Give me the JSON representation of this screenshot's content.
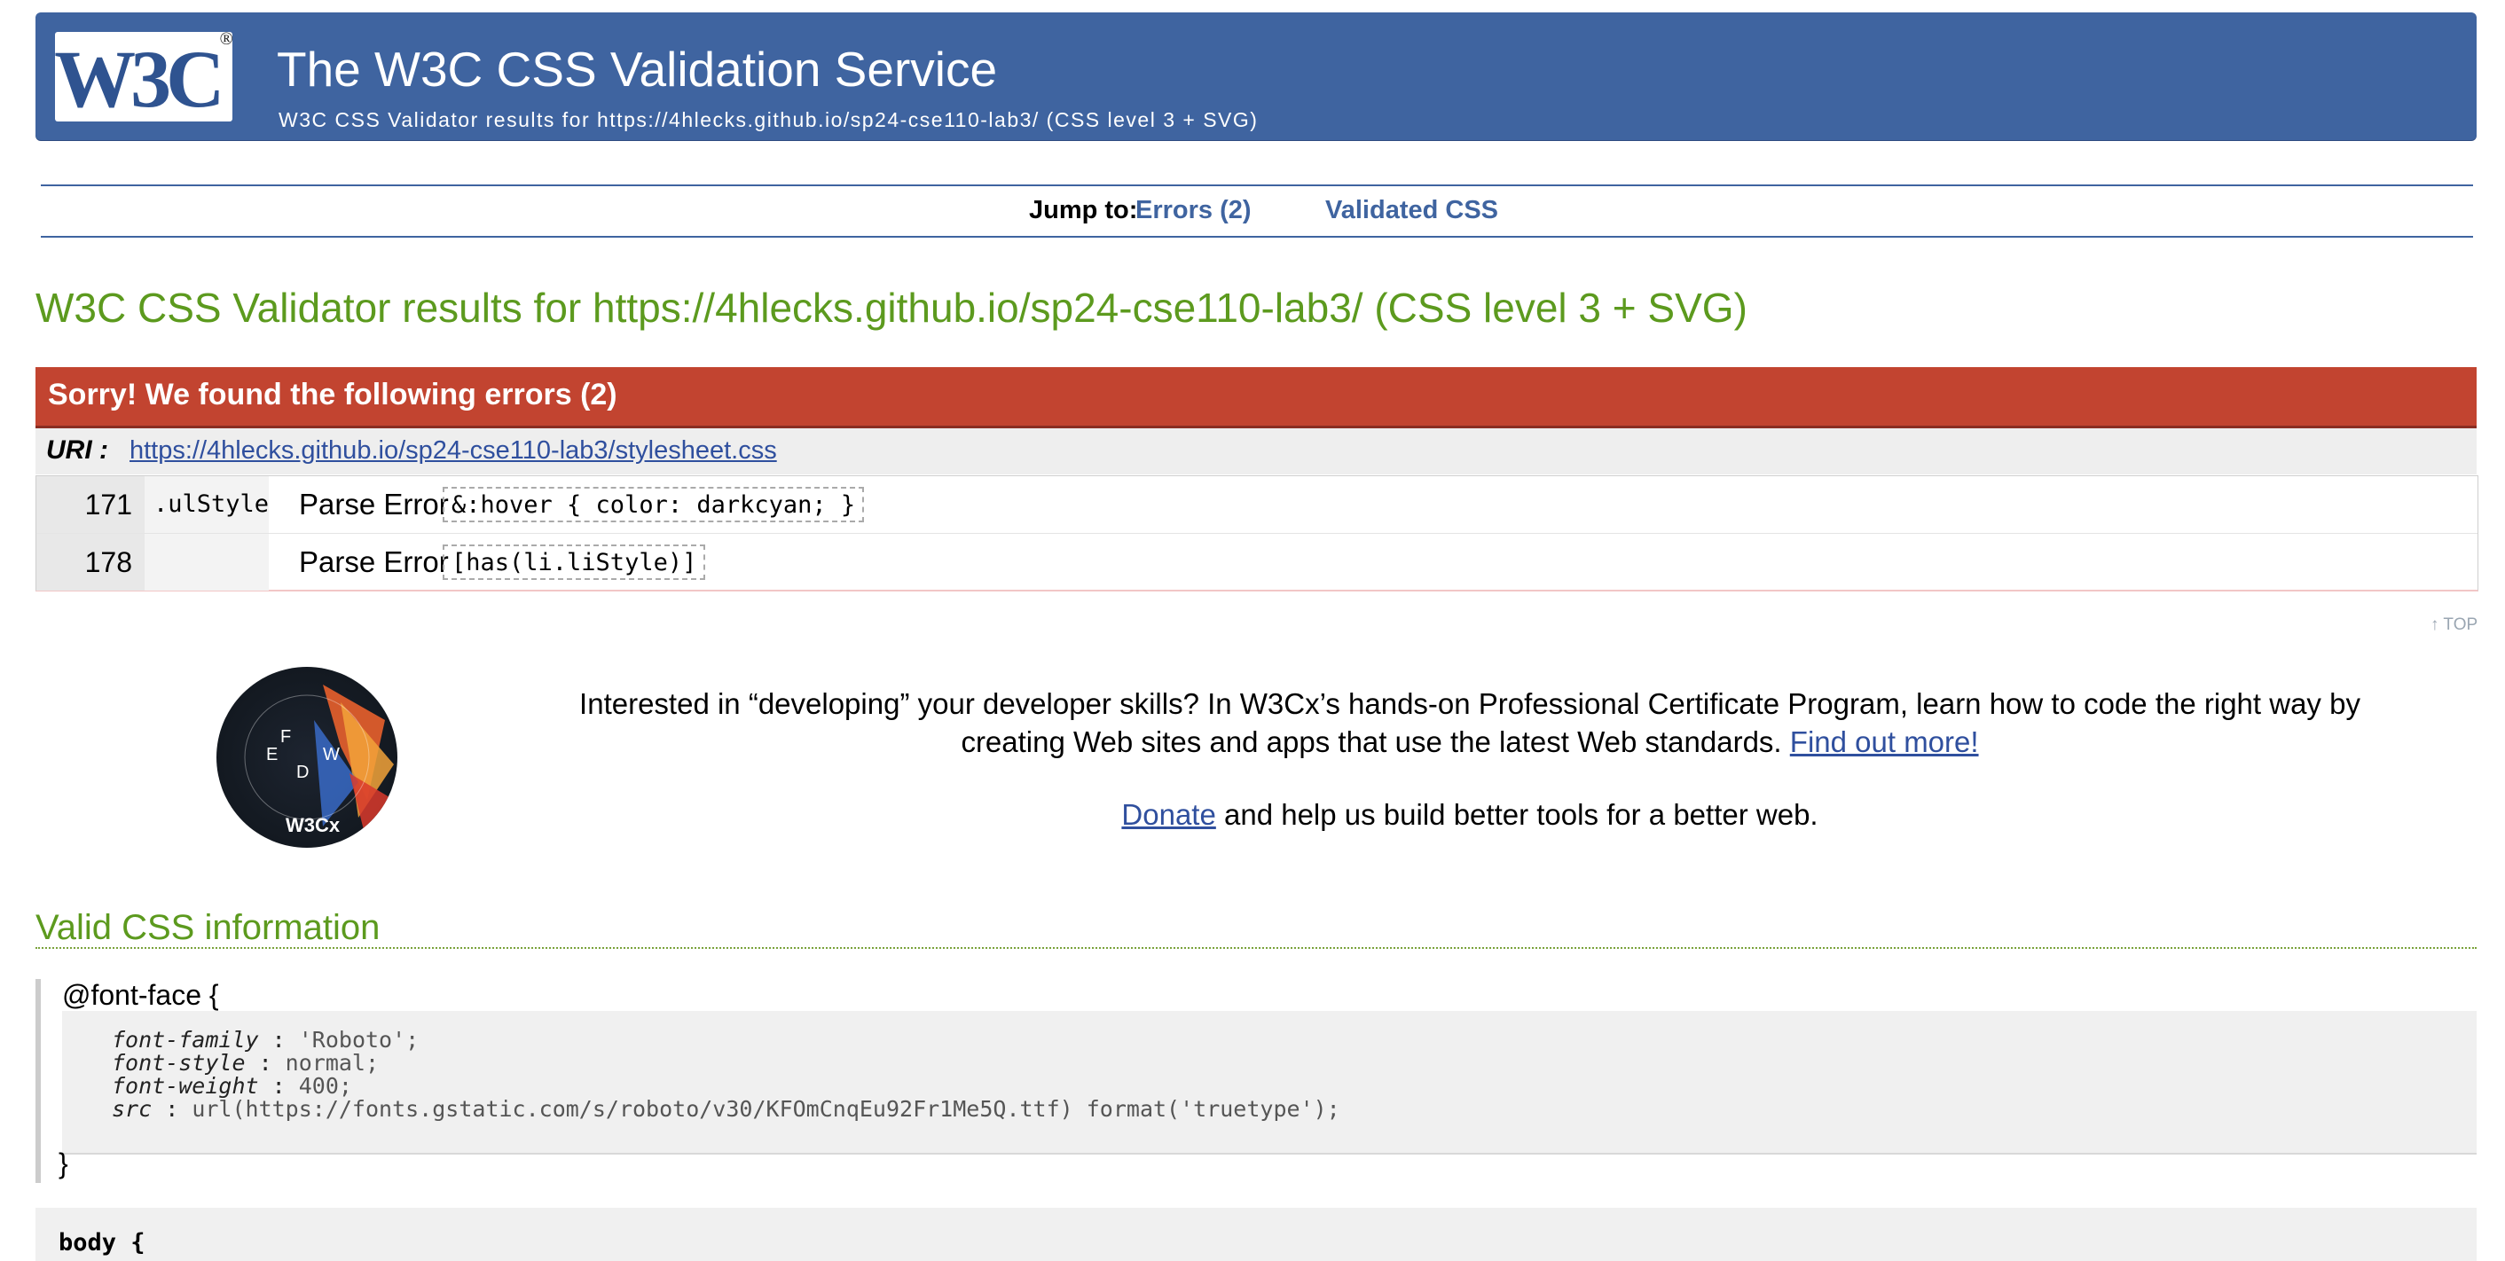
{
  "header": {
    "logo_text": "W3C",
    "title": "The W3C CSS Validation Service",
    "subtitle": "W3C CSS Validator results for https://4hlecks.github.io/sp24-cse110-lab3/ (CSS level 3 + SVG)"
  },
  "jump_nav": {
    "label": "Jump to:",
    "links": [
      "Errors (2)",
      "Validated CSS"
    ]
  },
  "results_title": "W3C CSS Validator results for https://4hlecks.github.io/sp24-cse110-lab3/ (CSS level 3 + SVG)",
  "errors": {
    "header": "Sorry! We found the following errors (2)",
    "uri_label": "URI :",
    "uri": "https://4hlecks.github.io/sp24-cse110-lab3/stylesheet.css",
    "rows": [
      {
        "line": "171",
        "context": ".ulStyle",
        "message": "Parse Error",
        "code": "&:hover { color: darkcyan; }"
      },
      {
        "line": "178",
        "context": "",
        "message": "Parse Error",
        "code": "[has(li.liStyle)]"
      }
    ]
  },
  "top_link": "↑ TOP",
  "promo": {
    "badge_text": "W3Cx",
    "text": "Interested in “developing” your developer skills? In W3Cx’s hands-on Professional Certificate Program, learn how to code the right way by creating Web sites and apps that use the latest Web standards.",
    "link": "Find out more!",
    "donate_link": "Donate",
    "donate_text": " and help us build better tools for a better web."
  },
  "valid_css": {
    "title": "Valid CSS information",
    "font_face": {
      "at_rule": "@font-face {",
      "declarations": [
        {
          "prop": "font-family",
          "val": "'Roboto';"
        },
        {
          "prop": "font-style",
          "val": "normal;"
        },
        {
          "prop": "font-weight",
          "val": "400;"
        },
        {
          "prop": "src",
          "val": "url(https://fonts.gstatic.com/s/roboto/v30/KFOmCnqEu92Fr1Me5Q.ttf) format('truetype');"
        }
      ],
      "close": "}"
    },
    "next_selector": "body {"
  },
  "colors": {
    "banner": "#3f64a0",
    "error_header": "#c24430",
    "title_green": "#5c9a1e",
    "link": "#2f4f9e"
  }
}
